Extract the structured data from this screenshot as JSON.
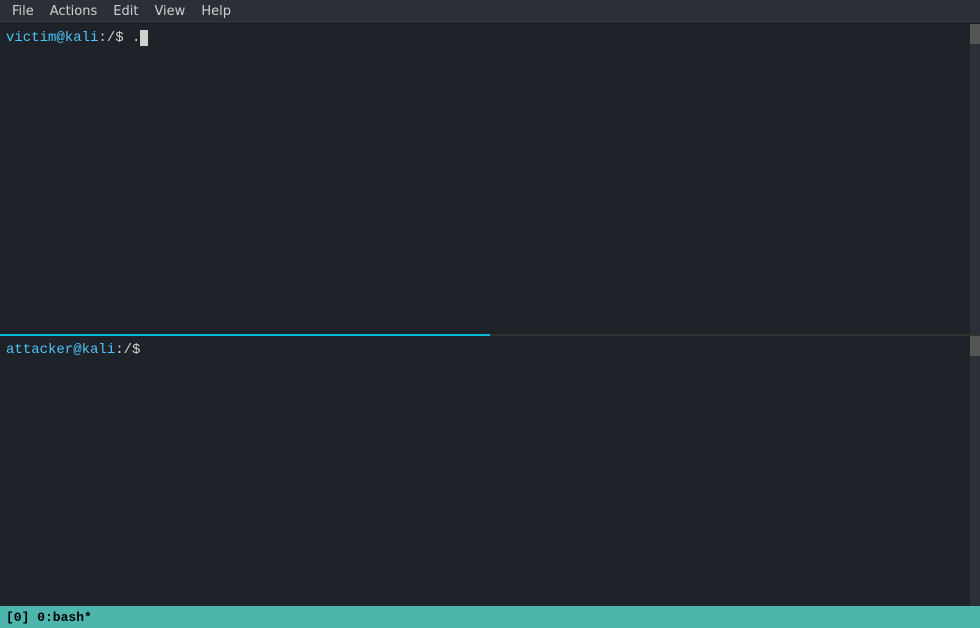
{
  "menubar": {
    "items": [
      "File",
      "Actions",
      "Edit",
      "View",
      "Help"
    ]
  },
  "terminal": {
    "pane_top": {
      "prompt_user": "victim@kali",
      "prompt_path": ":/",
      "prompt_dollar": "$",
      "prompt_input": " ."
    },
    "pane_bottom": {
      "prompt_user": "attacker@kali",
      "prompt_path": ":/",
      "prompt_dollar": "$"
    }
  },
  "statusbar": {
    "text": "[0] 0:bash*"
  }
}
